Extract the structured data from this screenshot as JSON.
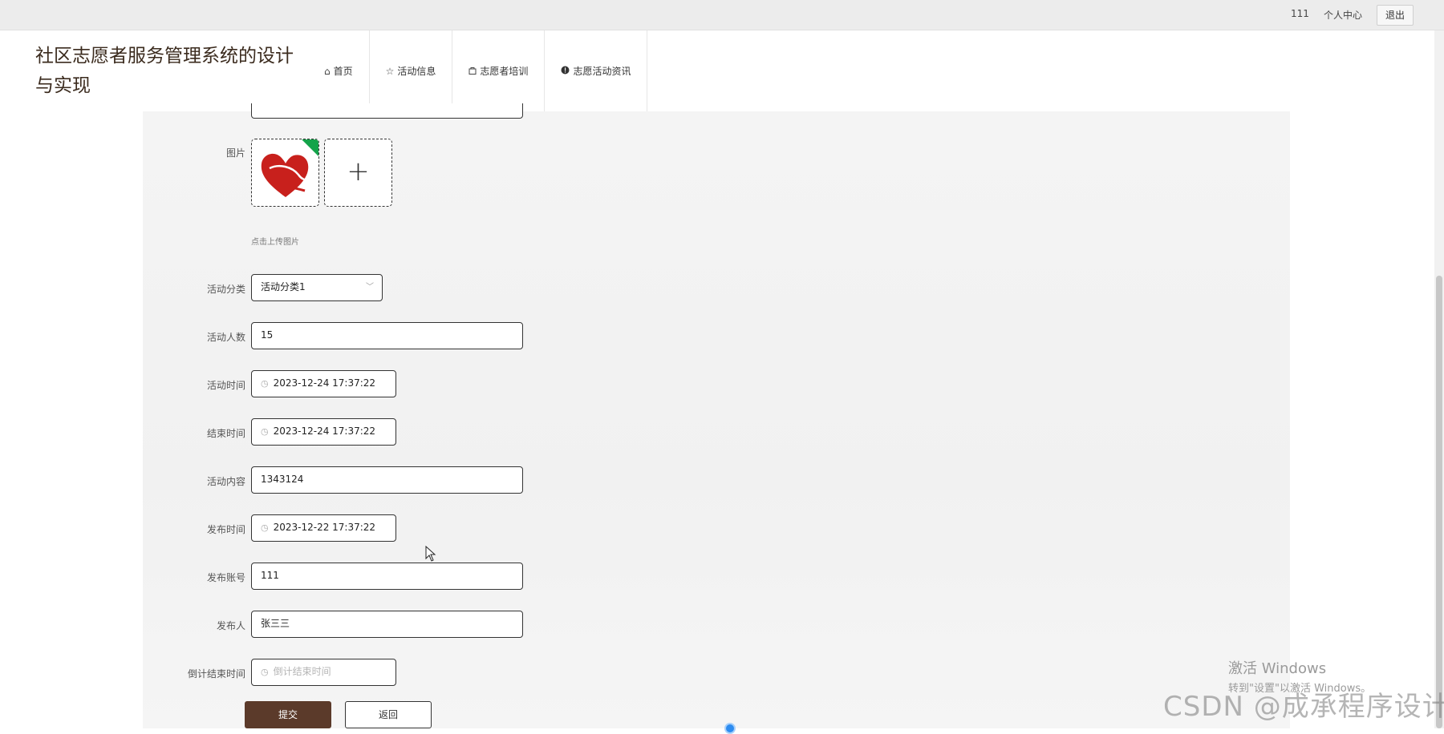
{
  "topbar": {
    "username": "111",
    "profile_label": "个人中心",
    "logout_label": "退出"
  },
  "header": {
    "site_title": "社区志愿者服务管理系统的设计与实现",
    "nav": [
      {
        "label": "首页",
        "icon": "home-icon"
      },
      {
        "label": "活动信息",
        "icon": "star-icon"
      },
      {
        "label": "志愿者培训",
        "icon": "bag-icon"
      },
      {
        "label": "志愿活动资讯",
        "icon": "info-icon"
      }
    ]
  },
  "form": {
    "image_label": "图片",
    "upload_hint": "点击上传图片",
    "category": {
      "label": "活动分类",
      "value": "活动分类1"
    },
    "people": {
      "label": "活动人数",
      "value": "15"
    },
    "activity_time": {
      "label": "活动时间",
      "value": "2023-12-24 17:37:22"
    },
    "end_time": {
      "label": "结束时间",
      "value": "2023-12-24 17:37:22"
    },
    "content": {
      "label": "活动内容",
      "value": "1343124"
    },
    "publish_time": {
      "label": "发布时间",
      "value": "2023-12-22 17:37:22"
    },
    "publish_account": {
      "label": "发布账号",
      "value": "111"
    },
    "publisher": {
      "label": "发布人",
      "value": "张三三"
    },
    "countdown_end": {
      "label": "倒计结束时间",
      "placeholder": "倒计结束时间"
    },
    "submit_label": "提交",
    "back_label": "返回"
  },
  "overlay": {
    "activate_title": "激活 Windows",
    "activate_sub": "转到\"设置\"以激活 Windows。",
    "watermark": "CSDN @成承程序设计"
  }
}
